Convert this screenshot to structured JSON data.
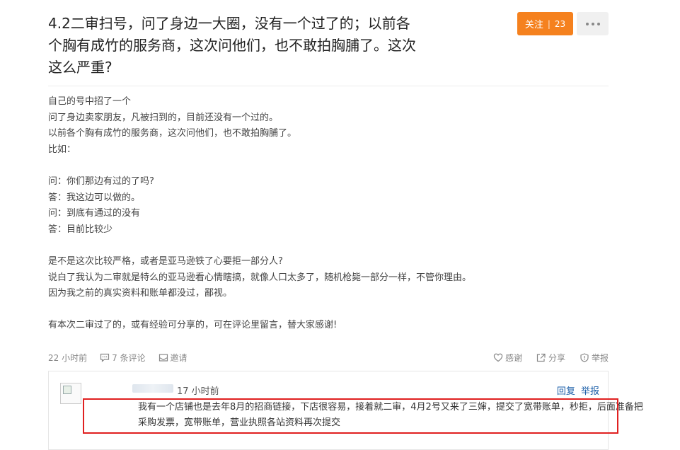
{
  "post": {
    "title": "4.2二审扫号，问了身边一大圈，没有一个过了的；以前各个胸有成竹的服务商，这次问他们，也不敢拍胸脯了。这次这么严重?",
    "follow_label": "关注",
    "follow_count": "23",
    "body_lines": [
      "自己的号中招了一个",
      "问了身边卖家朋友，凡被扫到的，目前还没有一个过的。",
      "以前各个胸有成竹的服务商，这次问他们，也不敢拍胸脯了。",
      "比如：",
      "",
      "问：你们那边有过的了吗?",
      "答：我这边可以做的。",
      "问：到底有通过的没有",
      "答：目前比较少",
      "",
      "是不是这次比较严格，或者是亚马逊铁了心要拒一部分人?",
      "说白了我认为二审就是特么的亚马逊看心情瞎搞，就像人口太多了，随机枪毙一部分一样，不管你理由。",
      "因为我之前的真实资料和账单都没过，鄙视。",
      "",
      "有本次二审过了的，或有经验可分享的，可在评论里留言，替大家感谢!"
    ],
    "meta": {
      "time": "22 小时前",
      "comments": "7 条评论",
      "invite": "邀请",
      "thanks": "感谢",
      "share": "分享",
      "report": "举报"
    }
  },
  "comment": {
    "time": "17 小时前",
    "reply": "回复",
    "report": "举报",
    "text": "我有一个店铺也是去年8月的招商链接，下店很容易，接着就二审，4月2号又来了三婶，提交了宽带账单，秒拒，后面准备把采购发票，宽带账单，营业执照各站资料再次提交"
  },
  "colors": {
    "accent": "#f5811e",
    "link": "#1a5ea8",
    "highlight": "#e02020"
  }
}
